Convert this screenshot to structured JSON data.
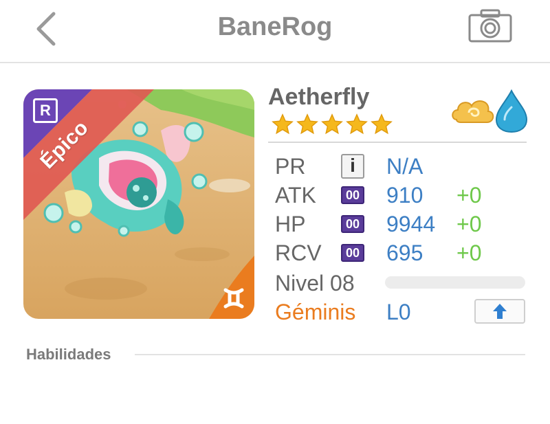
{
  "header": {
    "title": "BaneRog"
  },
  "monster": {
    "name": "Aetherfly",
    "rarity_code": "R",
    "rarity_label": "Épico",
    "stars": 5,
    "elements": [
      "cloud-element-icon",
      "water-element-icon"
    ],
    "colors": {
      "rarity_banner": "#e05a52",
      "corner_purple": "#6b45b5",
      "sign_badge": "#ea7c1f"
    }
  },
  "stats": [
    {
      "label": "PR",
      "icon": "info-icon",
      "icon_text": "i",
      "value": "N/A",
      "bonus": ""
    },
    {
      "label": "ATK",
      "icon": "rune-icon",
      "icon_text": "00",
      "value": "910",
      "bonus": "+0"
    },
    {
      "label": "HP",
      "icon": "rune-icon",
      "icon_text": "00",
      "value": "9944",
      "bonus": "+0"
    },
    {
      "label": "RCV",
      "icon": "rune-icon",
      "icon_text": "00",
      "value": "695",
      "bonus": "+0"
    }
  ],
  "level": {
    "label": "Nivel 08",
    "progress": 0.0
  },
  "sign": {
    "label": "Géminis",
    "level": "L0"
  },
  "sections": {
    "abilities_title": "Habilidades"
  }
}
